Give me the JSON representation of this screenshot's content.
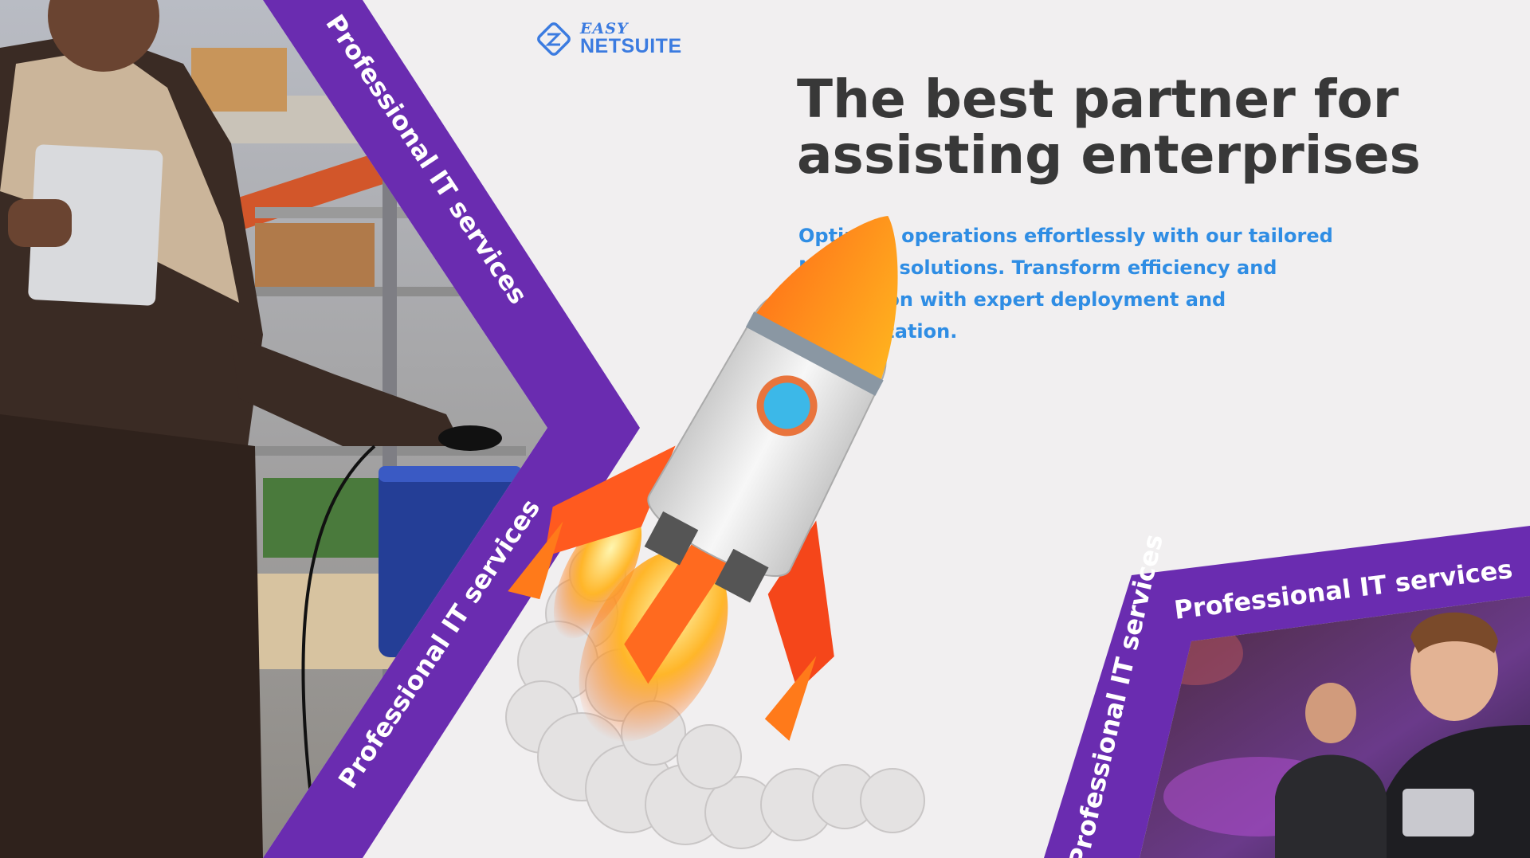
{
  "brand": {
    "line1": "EASY",
    "line2": "NETSUITE"
  },
  "hero": {
    "headline_line1": "The best partner for",
    "headline_line2": "assisting enterprises",
    "description": "Optimize operations effortlessly with our tailored NetSuite solutions. Transform efficiency and innovation with expert deployment and customization."
  },
  "banners": {
    "left_top": "Professional IT services",
    "left_bottom": "Professional IT services",
    "right_top": "Professional IT services",
    "right_side": "Professional IT services"
  },
  "colors": {
    "background": "#f1eff0",
    "purple": "#6a2cb0",
    "brand_blue": "#3b7be0",
    "headline": "#383838",
    "description": "#2f8de4"
  },
  "icons": [
    "logo-mark-icon",
    "rocket-illustration",
    "warehouse-worker-photo",
    "developer-photo"
  ]
}
